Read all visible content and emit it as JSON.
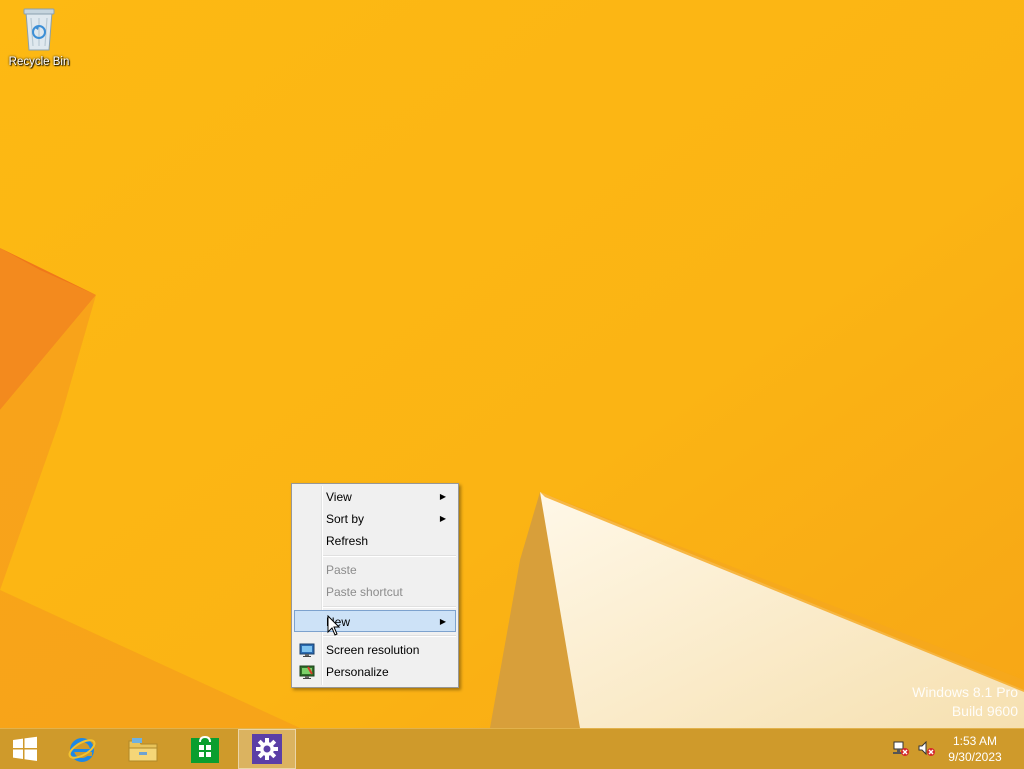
{
  "desktop": {
    "icons": [
      {
        "label": "Recycle Bin",
        "icon": "recycle-bin-icon"
      }
    ],
    "watermark": {
      "line1": "Windows 8.1 Pro",
      "line2": "Build 9600"
    }
  },
  "context_menu": {
    "items": [
      {
        "label": "View",
        "submenu": true
      },
      {
        "label": "Sort by",
        "submenu": true
      },
      {
        "label": "Refresh"
      },
      {
        "label": "Paste",
        "disabled": true
      },
      {
        "label": "Paste shortcut",
        "disabled": true
      },
      {
        "label": "New",
        "submenu": true,
        "highlighted": true
      },
      {
        "label": "Screen resolution",
        "icon": "screen-resolution-icon"
      },
      {
        "label": "Personalize",
        "icon": "personalize-icon"
      }
    ],
    "submenu_arrow": "▶"
  },
  "taskbar": {
    "buttons": [
      {
        "name": "start",
        "icon": "windows-logo-icon"
      },
      {
        "name": "internet-explorer",
        "icon": "internet-explorer-icon"
      },
      {
        "name": "file-explorer",
        "icon": "folder-icon"
      },
      {
        "name": "store",
        "icon": "store-icon"
      },
      {
        "name": "settings",
        "icon": "gear-icon",
        "active": true
      }
    ],
    "tray": {
      "network": "network-disconnected-icon",
      "volume": "volume-muted-icon"
    },
    "clock": {
      "time": "1:53 AM",
      "date": "9/30/2023"
    }
  },
  "colors": {
    "wallpaper": "#fbb514",
    "menu_highlight": "#cde2f7",
    "taskbar": "#cf9a2b",
    "settings_tile": "#5b3fa6"
  }
}
